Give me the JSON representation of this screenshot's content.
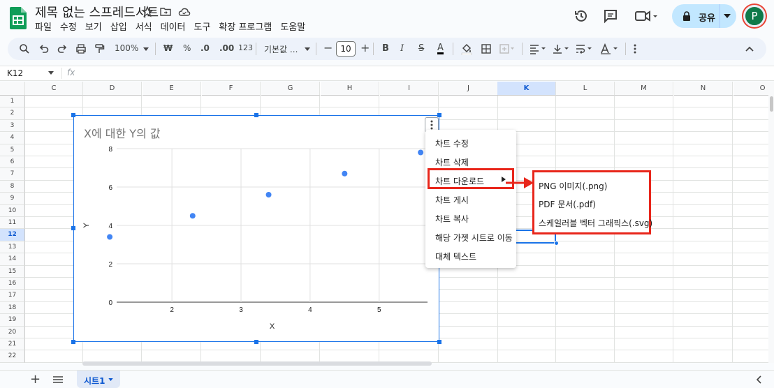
{
  "app": {
    "doc_title": "제목 없는 스프레드시트",
    "brand_color": "#0f9d58"
  },
  "menubar": [
    "파일",
    "수정",
    "보기",
    "삽입",
    "서식",
    "데이터",
    "도구",
    "확장 프로그램",
    "도움말"
  ],
  "share": {
    "label": "공유",
    "bg": "#c2e7ff"
  },
  "avatar": {
    "letter": "P"
  },
  "toolbar": {
    "zoom": "100%",
    "currency": "₩",
    "percent": "%",
    "dec_minus": ".0",
    "dec_plus": ".00",
    "number_format": "123",
    "font": "기본값 ...",
    "font_size": "10"
  },
  "formula": {
    "cell_ref": "K12",
    "fx": "fx"
  },
  "columns": [
    "C",
    "D",
    "E",
    "F",
    "G",
    "H",
    "I",
    "J",
    "K",
    "L",
    "M",
    "N",
    "O"
  ],
  "rows": [
    "1",
    "2",
    "3",
    "4",
    "5",
    "6",
    "7",
    "8",
    "9",
    "10",
    "11",
    "12",
    "13",
    "14",
    "15",
    "16",
    "17",
    "18",
    "19",
    "20",
    "21",
    "22"
  ],
  "selected": {
    "column": "K",
    "row": "12"
  },
  "chart_data": {
    "type": "scatter",
    "title": "X에 대한 Y의 값",
    "xlabel": "X",
    "ylabel": "Y",
    "x_ticks": [
      "2",
      "3",
      "4",
      "5"
    ],
    "y_ticks": [
      "0",
      "2",
      "4",
      "6",
      "8"
    ],
    "xlim": [
      1.2,
      5.7
    ],
    "ylim": [
      0,
      8
    ],
    "points": [
      {
        "x": 1.1,
        "y": 3.4
      },
      {
        "x": 2.3,
        "y": 4.5
      },
      {
        "x": 3.4,
        "y": 5.6
      },
      {
        "x": 4.5,
        "y": 6.7
      },
      {
        "x": 5.6,
        "y": 7.8
      }
    ],
    "point_color": "#4285f4",
    "grid": true
  },
  "context_menu": [
    "차트 수정",
    "차트 삭제",
    "차트 다운로드",
    "차트 게시",
    "차트 복사",
    "해당 가젯 시트로 이동",
    "대체 텍스트"
  ],
  "submenu": [
    "PNG 이미지(.png)",
    "PDF 문서(.pdf)",
    "스케일러블 벡터 그래픽스(.svg)"
  ],
  "highlight_color": "#e8261b",
  "sheet_tab": {
    "label": "시트1"
  }
}
